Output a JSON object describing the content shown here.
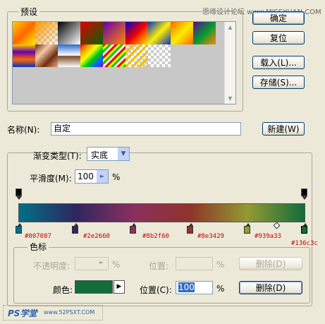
{
  "watermark": "思缘设计论坛 www.MISSYUAN.COM",
  "presets": {
    "title": "预设"
  },
  "buttons": {
    "ok": "确定",
    "reset": "复位",
    "load": "载入(L)...",
    "save": "存储(S)...",
    "new": "新建(W)"
  },
  "name": {
    "label": "名称(N):",
    "value": "自定"
  },
  "gradient": {
    "type_label": "渐变类型(T):",
    "type_value": "实底",
    "smoothness_label": "平滑度(M):",
    "smoothness_value": "100",
    "percent": "%"
  },
  "stops": [
    {
      "color": "#007087",
      "label": "#007087"
    },
    {
      "color": "#2e2660",
      "label": "#2e2660"
    },
    {
      "color": "#8b2f60",
      "label": "#8b2f60"
    },
    {
      "color": "#8e3429",
      "label": "#8e3429"
    },
    {
      "color": "#939a33",
      "label": "#939a33"
    },
    {
      "color": "#136c3c",
      "label": "#136c3c"
    }
  ],
  "color_stops": {
    "title": "色标",
    "opacity_label": "不透明度:",
    "opacity_unit": "%",
    "location_label": "位置:",
    "location_unit": "%",
    "delete": "删除(D)",
    "color_label": "颜色:",
    "color_value": "#136c3c",
    "color_location_label": "位置(C):",
    "color_location_value": "100",
    "color_location_unit": "%",
    "color_delete": "删除(D)"
  },
  "footer": {
    "logo": "PS学堂",
    "site": "www.52PSXT.COM"
  }
}
